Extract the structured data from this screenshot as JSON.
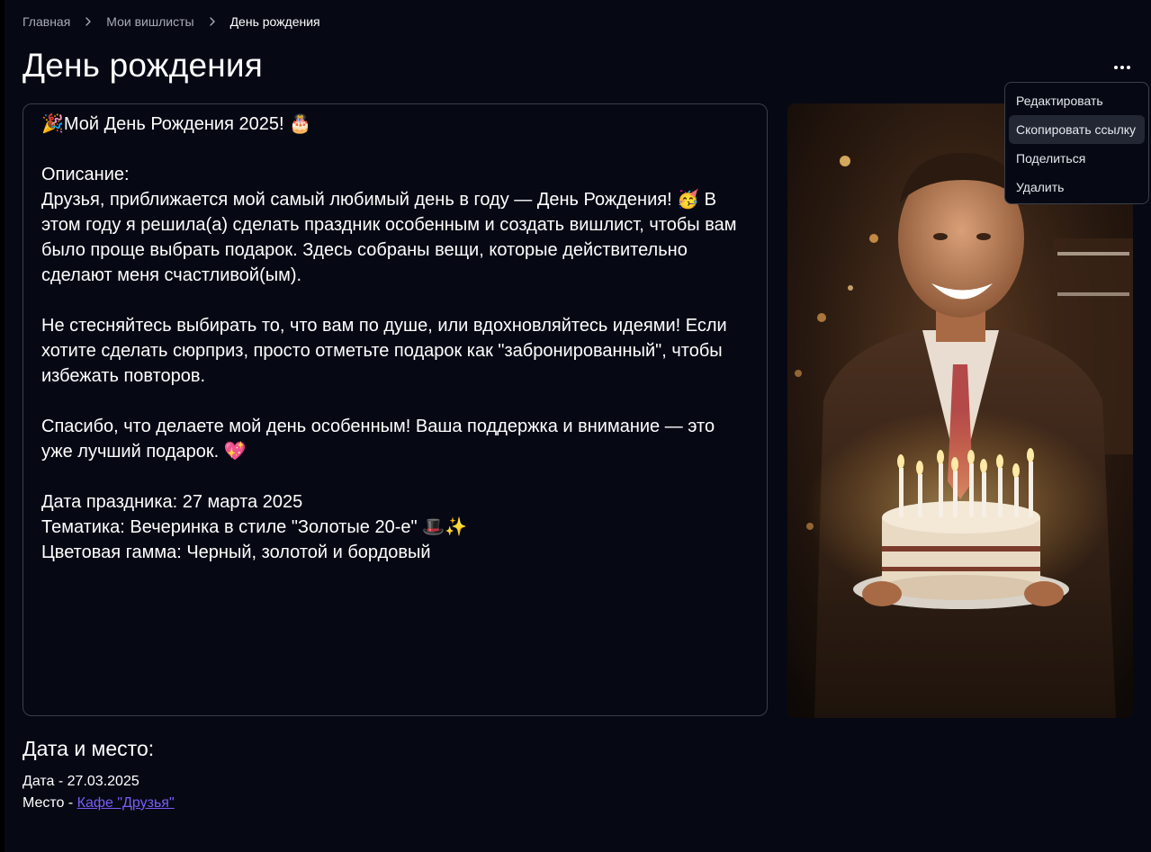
{
  "breadcrumb": {
    "items": [
      "Главная",
      "Мои вишлисты"
    ],
    "current": "День рождения"
  },
  "page": {
    "title": "День рождения"
  },
  "description": {
    "title_line": "🎉Мой День Рождения 2025! 🎂",
    "label": "Описание:",
    "paragraph1": "Друзья, приближается мой самый любимый день в году — День Рождения! 🥳 В этом году я решила(а) сделать праздник особенным и создать вишлист, чтобы вам было проще выбрать подарок. Здесь собраны вещи, которые действительно сделают меня счастливой(ым).",
    "paragraph2": "Не стесняйтесь выбирать то, что вам по душе, или вдохновляйтесь идеями! Если хотите сделать сюрприз, просто отметьте подарок как \"забронированный\", чтобы избежать повторов.",
    "paragraph3": "Спасибо, что делаете мой день особенным! Ваша поддержка и внимание — это уже лучший подарок. 💖",
    "date_line": "Дата праздника: 27 марта 2025",
    "theme_line": "Тематика: Вечеринка в стиле \"Золотые 20-е\" 🎩✨",
    "colors_line": "Цветовая гамма: Черный, золотой и бордовый"
  },
  "menu": {
    "items": [
      "Редактировать",
      "Скопировать ссылку",
      "Поделиться",
      "Удалить"
    ],
    "active_index": 1
  },
  "details": {
    "title": "Дата и место:",
    "date_prefix": "Дата - ",
    "date_value": "27.03.2025",
    "place_prefix": "Место - ",
    "place_link": "Кафе \"Друзья\""
  },
  "icons": {
    "breadcrumb_separator": "chevron-right-icon",
    "more": "more-horizontal-icon"
  },
  "colors": {
    "background": "#060914",
    "border": "#3b3f4a",
    "link": "#7b5cf6",
    "menu_active": "#222733"
  }
}
